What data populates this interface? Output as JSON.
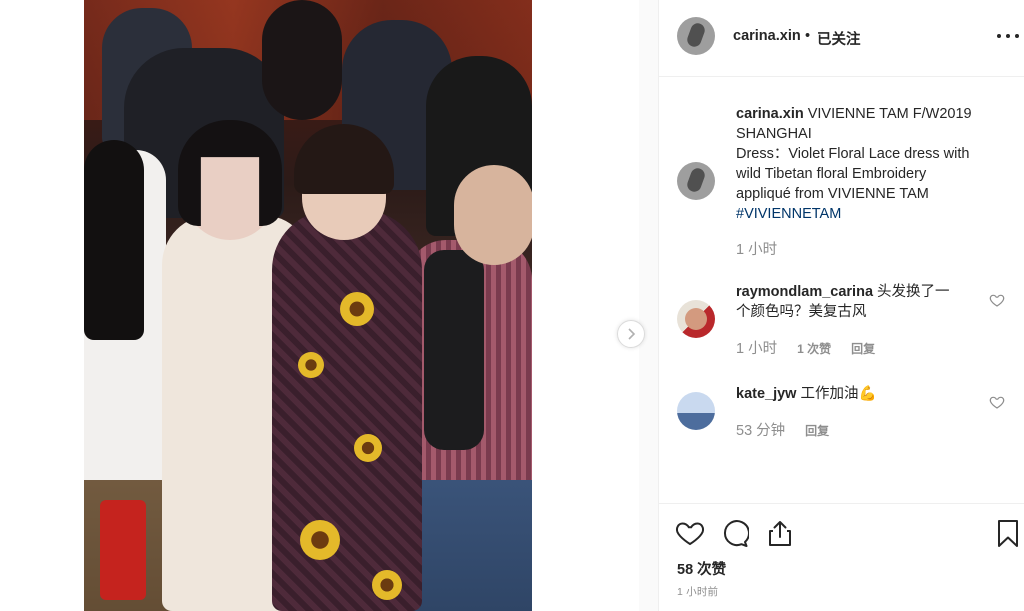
{
  "post": {
    "username": "carina.xin",
    "separator": "•",
    "follow_status": "已关注",
    "caption_line1": "VIVIENNE TAM F/W2019",
    "caption_line2": "SHANGHAI",
    "caption_line3": "Dress：Violet Floral Lace dress with",
    "caption_line4": "wild Tibetan floral Embroidery",
    "caption_line5": "appliqué from VIVIENNE TAM",
    "hashtag": "#VIVIENNETAM",
    "caption_time": "1 小时"
  },
  "comments": [
    {
      "username": "raymondlam_carina",
      "text_line1": "头发换了一",
      "text_line2": "个颜色吗？美复古风",
      "time": "1 小时",
      "likes": "1 次赞",
      "reply": "回复"
    },
    {
      "username": "kate_jyw",
      "text": "工作加油💪",
      "time": "53 分钟",
      "reply": "回复"
    }
  ],
  "footer": {
    "likes_count": "58 次赞",
    "post_time": "1 小时前"
  },
  "icons": {
    "like": "heart-icon",
    "comment": "comment-icon",
    "share": "share-icon",
    "save": "bookmark-icon",
    "more": "more-options-icon",
    "next": "chevron-right-icon"
  },
  "colors": {
    "text": "#262626",
    "muted": "#8e8e8e",
    "hashtag": "#003569",
    "divider": "#efefef"
  }
}
